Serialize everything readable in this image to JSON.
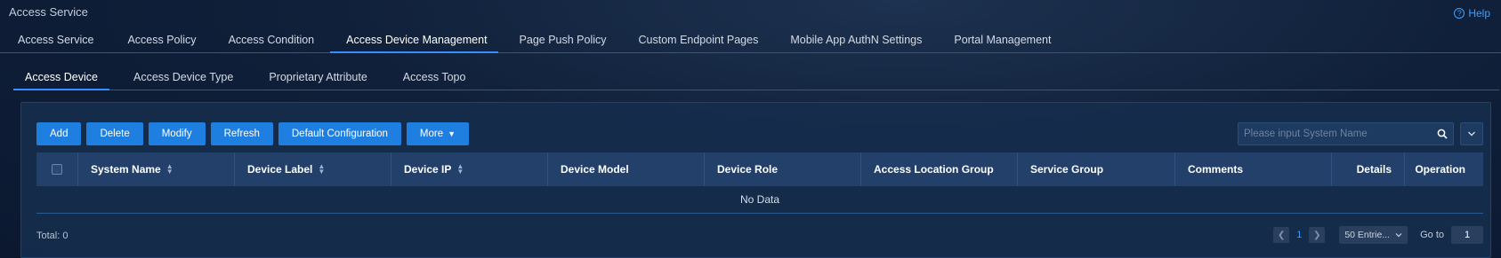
{
  "header": {
    "title": "Access Service",
    "help_label": "Help"
  },
  "main_tabs": [
    {
      "label": "Access Service"
    },
    {
      "label": "Access Policy"
    },
    {
      "label": "Access Condition"
    },
    {
      "label": "Access Device Management"
    },
    {
      "label": "Page Push Policy"
    },
    {
      "label": "Custom Endpoint Pages"
    },
    {
      "label": "Mobile App AuthN Settings"
    },
    {
      "label": "Portal Management"
    }
  ],
  "sub_tabs": [
    {
      "label": "Access Device"
    },
    {
      "label": "Access Device Type"
    },
    {
      "label": "Proprietary Attribute"
    },
    {
      "label": "Access Topo"
    }
  ],
  "toolbar": {
    "add": "Add",
    "delete": "Delete",
    "modify": "Modify",
    "refresh": "Refresh",
    "default_config": "Default Configuration",
    "more": "More"
  },
  "search": {
    "placeholder": "Please input System Name"
  },
  "table": {
    "columns": [
      {
        "label": "System Name"
      },
      {
        "label": "Device Label"
      },
      {
        "label": "Device IP"
      },
      {
        "label": "Device Model"
      },
      {
        "label": "Device Role"
      },
      {
        "label": "Access Location Group"
      },
      {
        "label": "Service Group"
      },
      {
        "label": "Comments"
      },
      {
        "label": "Details"
      },
      {
        "label": "Operation"
      }
    ],
    "empty_text": "No Data"
  },
  "footer": {
    "total": "Total: 0",
    "current_page": "1",
    "page_size": "50 Entrie...",
    "goto_label": "Go to",
    "goto_value": "1"
  },
  "colors": {
    "accent": "#1f7fe0",
    "link": "#3aa0ff",
    "header_bg": "#23406a"
  }
}
